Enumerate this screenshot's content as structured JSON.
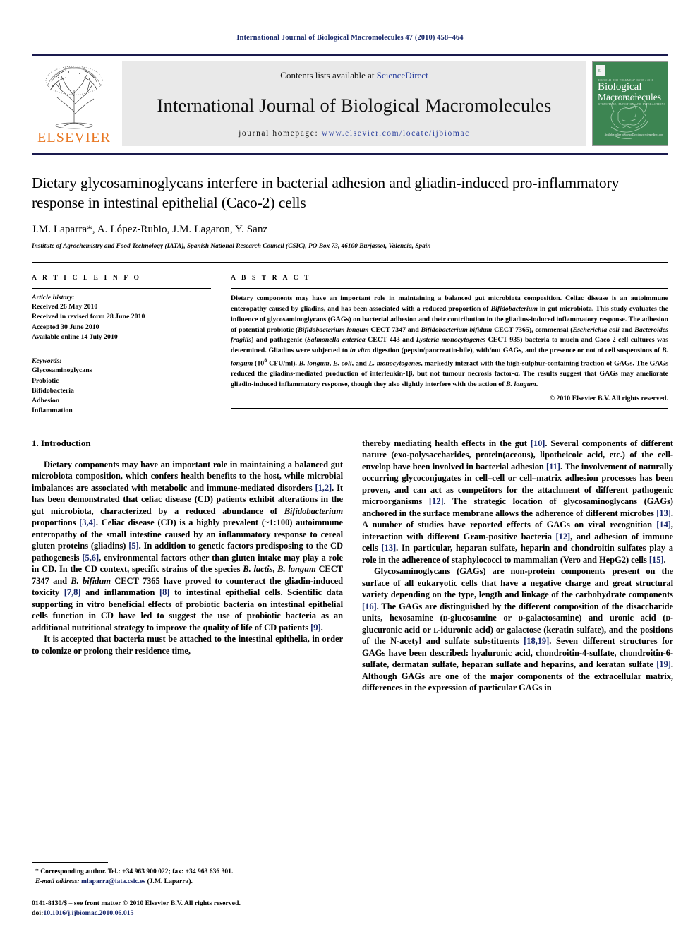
{
  "running_head": "International Journal of Biological Macromolecules 47 (2010) 458–464",
  "masthead": {
    "contents_prefix": "Contents lists available at ",
    "sciencedirect": "ScienceDirect",
    "journal_title": "International Journal of Biological Macromolecules",
    "homepage_label": "journal homepage:",
    "homepage_url": "www.elsevier.com/locate/ijbiomac",
    "publisher": "ELSEVIER",
    "cover": {
      "issn_line": "ISSN 0141-8130  VOLUME 47  ISSUE 4  2010",
      "title_line1": "Biological",
      "title_line2": "Macromolecules",
      "subtitle": "STRUCTURE, FUNCTION AND INTERACTIONS",
      "credit": "Available online at\nScienceDirect\nwww.sciencedirect.com"
    }
  },
  "article": {
    "title": "Dietary glycosaminoglycans interfere in bacterial adhesion and gliadin-induced pro-inflammatory response in intestinal epithelial (Caco-2) cells",
    "authors": "J.M. Laparra*, A. López-Rubio, J.M. Lagaron, Y. Sanz",
    "affiliation": "Institute of Agrochemistry and Food Technology (IATA), Spanish National Research Council (CSIC), PO Box 73, 46100 Burjassot, Valencia, Spain"
  },
  "article_info": {
    "heading": "A R T I C L E   I N F O",
    "history_label": "Article history:",
    "history": [
      "Received 26 May 2010",
      "Received in revised form 28 June 2010",
      "Accepted 30 June 2010",
      "Available online 14 July 2010"
    ],
    "keywords_label": "Keywords:",
    "keywords": [
      "Glycosaminoglycans",
      "Probiotic",
      "Bifidobacteria",
      "Adhesion",
      "Inflammation"
    ]
  },
  "abstract": {
    "heading": "A B S T R A C T",
    "text": "Dietary components may have an important role in maintaining a balanced gut microbiota composition. Celiac disease is an autoimmune enteropathy caused by gliadins, and has been associated with a reduced proportion of <i>Bifidobacterium</i> in gut microbiota. This study evaluates the influence of glycosaminoglycans (GAGs) on bacterial adhesion and their contribution in the gliadins-induced inflammatory response. The adhesion of potential probiotic (<i>Bifidobacterium longum</i> CECT 7347 and <i>Bifidobacterium bifidum</i> CECT 7365), commensal (<i>Escherichia coli</i> and <i>Bacteroides fragilis</i>) and pathogenic (<i>Salmonella enterica</i> CECT 443 and <i>Lysteria monocytogenes</i> CECT 935) bacteria to mucin and Caco-2 cell cultures was determined. Gliadins were subjected to <i>in vitro</i> digestion (pepsin/pancreatin-bile), with/out GAGs, and the presence or not of cell suspensions of <i>B. longum</i> (10<sup>8</sup> CFU/ml). <i>B. longum</i>, <i>E. coli</i>, and <i>L. monocytogenes</i>, markedly interact with the high-sulphur-containing fraction of GAGs. The GAGs reduced the gliadins-mediated production of interleukin-1β, but not tumour necrosis factor-α. The results suggest that GAGs may ameliorate gliadin-induced inflammatory response, though they also slightly interfere with the action of <i>B. longum</i>.",
    "copyright": "© 2010 Elsevier B.V. All rights reserved."
  },
  "introduction": {
    "heading": "1. Introduction",
    "left_paragraphs": [
      "Dietary components may have an important role in maintaining a balanced gut microbiota composition, which confers health benefits to the host, while microbial imbalances are associated with metabolic and immune-mediated disorders <span class=\"ref\">[1,2]</span>. It has been demonstrated that celiac disease (CD) patients exhibit alterations in the gut microbiota, characterized by a reduced abundance of <i>Bifidobacterium</i> proportions <span class=\"ref\">[3,4]</span>. Celiac disease (CD) is a highly prevalent (~1:100) autoimmune enteropathy of the small intestine caused by an inflammatory response to cereal gluten proteins (gliadins) <span class=\"ref\">[5]</span>. In addition to genetic factors predisposing to the CD pathogenesis <span class=\"ref\">[5,6]</span>, environmental factors other than gluten intake may play a role in CD. In the CD context, specific strains of the species <i>B. lactis</i>, <i>B. longum</i> CECT 7347 and <i>B. bifidum</i> CECT 7365 have proved to counteract the gliadin-induced toxicity <span class=\"ref\">[7,8]</span> and inflammation <span class=\"ref\">[8]</span> to intestinal epithelial cells. Scientific data supporting in vitro beneficial effects of probiotic bacteria on intestinal epithelial cells function in CD have led to suggest the use of probiotic bacteria as an additional nutritional strategy to improve the quality of life of CD patients <span class=\"ref\">[9]</span>.",
      "It is accepted that bacteria must be attached to the intestinal epithelia, in order to colonize or prolong their residence time,"
    ],
    "right_paragraphs": [
      "thereby mediating health effects in the gut <span class=\"ref\">[10]</span>. Several components of different nature (exo-polysaccharides, protein(aceous), lipotheicoic acid, etc.) of the cell-envelop have been involved in bacterial adhesion <span class=\"ref\">[11]</span>. The involvement of naturally occurring glycoconjugates in cell–cell or cell–matrix adhesion processes has been proven, and can act as competitors for the attachment of different pathogenic microorganisms <span class=\"ref\">[12]</span>. The strategic location of glycosaminoglycans (GAGs) anchored in the surface membrane allows the adherence of different microbes <span class=\"ref\">[13]</span>. A number of studies have reported effects of GAGs on viral recognition <span class=\"ref\">[14]</span>, interaction with different Gram-positive bacteria <span class=\"ref\">[12]</span>, and adhesion of immune cells <span class=\"ref\">[13]</span>. In particular, heparan sulfate, heparin and chondroitin sulfates play a role in the adherence of staphylococci to mammalian (Vero and HepG2) cells <span class=\"ref\">[15]</span>.",
      "Glycosaminoglycans (GAGs) are non-protein components present on the surface of all eukaryotic cells that have a negative charge and great structural variety depending on the type, length and linkage of the carbohydrate components <span class=\"ref\">[16]</span>. The GAGs are distinguished by the different composition of the disaccharide units, hexosamine (<span class=\"sc\">d</span>-glucosamine or <span class=\"sc\">d</span>-galactosamine) and uronic acid (<span class=\"sc\">d</span>-glucuronic acid or <span class=\"sc\">l</span>-iduronic acid) or galactose (keratin sulfate), and the positions of the N-acetyl and sulfate substituents <span class=\"ref\">[18,19]</span>. Seven different structures for GAGs have been described: hyaluronic acid, chondroitin-4-sulfate, chondroitin-6-sulfate, dermatan sulfate, heparan sulfate and heparins, and keratan sulfate <span class=\"ref\">[19]</span>. Although GAGs are one of the major components of the extracellular matrix, differences in the expression of particular GAGs in"
    ]
  },
  "footnote": {
    "corresponding": "* Corresponding author. Tel.: +34 963 900 022; fax: +34 963 636 301.",
    "email_label": "E-mail address:",
    "email": "mlaparra@iata.csic.es",
    "email_suffix": "(J.M. Laparra).",
    "issn_line": "0141-8130/$ – see front matter © 2010 Elsevier B.V. All rights reserved.",
    "doi_label": "doi:",
    "doi": "10.1016/j.ijbiomac.2010.06.015"
  },
  "colors": {
    "header_blue": "#1a2a6c",
    "link_blue": "#2a3f9d",
    "ref_blue": "#16256b",
    "elsevier_orange": "#E87722",
    "cover_green": "#3d8552",
    "masthead_gray": "#e9e9e9"
  }
}
